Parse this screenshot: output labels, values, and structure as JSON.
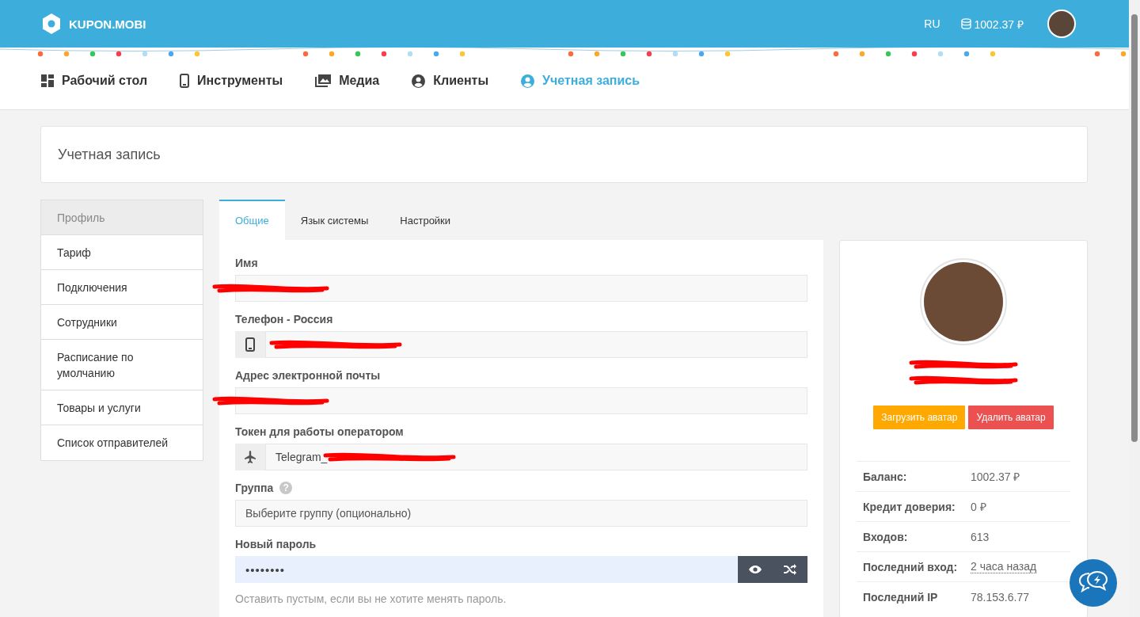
{
  "header": {
    "logo": "KUPON.MOBI",
    "language": "RU",
    "balance": "1002.37 ₽"
  },
  "nav": [
    {
      "label": "Рабочий стол",
      "selected": false
    },
    {
      "label": "Инструменты",
      "selected": false
    },
    {
      "label": "Медиа",
      "selected": false
    },
    {
      "label": "Клиенты",
      "selected": false
    },
    {
      "label": "Учетная запись",
      "selected": true
    }
  ],
  "page_title": "Учетная запись",
  "sidebar": [
    {
      "label": "Профиль",
      "selected": true
    },
    {
      "label": "Тариф",
      "selected": false
    },
    {
      "label": "Подключения",
      "selected": false
    },
    {
      "label": "Сотрудники",
      "selected": false
    },
    {
      "label": "Расписание по умолчанию",
      "selected": false
    },
    {
      "label": "Товары и услуги",
      "selected": false
    },
    {
      "label": "Список отправителей",
      "selected": false
    }
  ],
  "tabs": [
    {
      "label": "Общие",
      "selected": true
    },
    {
      "label": "Язык системы",
      "selected": false
    },
    {
      "label": "Настройки",
      "selected": false
    }
  ],
  "fields": [
    {
      "kind": "text",
      "label": "Имя",
      "redacted": true
    },
    {
      "kind": "addon",
      "label": "Телефон - Россия",
      "redacted": true
    },
    {
      "kind": "text",
      "label": "Адрес электронной почты",
      "redacted": true
    },
    {
      "kind": "addon",
      "label": "Токен для работы оператором",
      "value": "Telegram_",
      "redacted": true
    },
    {
      "kind": "select",
      "label": "Группа",
      "help": "?",
      "placeholder": "Выберите группу (опционально)"
    },
    {
      "kind": "password",
      "label": "Новый пароль",
      "value": "••••••••"
    }
  ],
  "password_hint": "Оставить пустым, если вы не хотите менять пароль.",
  "card": {
    "name_redacted": true,
    "buttons": [
      {
        "label": "Загрузить аватар",
        "kind": "upload"
      },
      {
        "label": "Удалить аватар",
        "kind": "delete"
      }
    ],
    "stats": [
      {
        "label": "Баланс:",
        "value": "1002.37 ₽",
        "dotted": false
      },
      {
        "label": "Кредит доверия:",
        "value": "0 ₽",
        "dotted": false
      },
      {
        "label": "Входов:",
        "value": "613",
        "dotted": false
      },
      {
        "label": "Последний вход:",
        "value": "2 часа назад",
        "dotted": true
      },
      {
        "label": "Последний IP",
        "value": "78.153.6.77",
        "dotted": false
      }
    ]
  }
}
